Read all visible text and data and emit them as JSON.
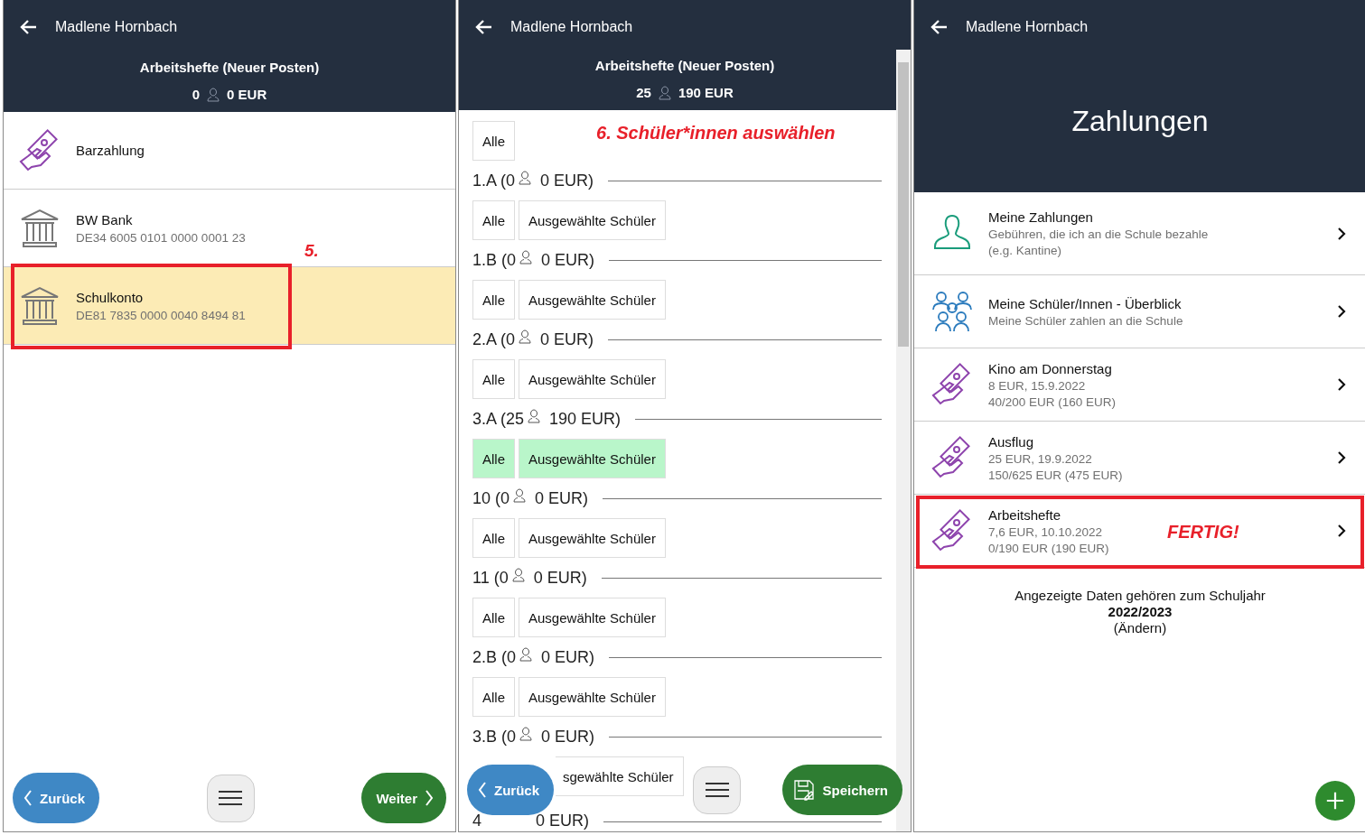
{
  "left_screen": {
    "user": "Madlene Hornbach",
    "title": "Arbeitshefte (Neuer Posten)",
    "count": "0",
    "amount": "0 EUR",
    "annotation": "5.",
    "accounts": [
      {
        "kind": "cash",
        "name": "Barzahlung",
        "selected": false,
        "highlighted": false
      },
      {
        "kind": "bank",
        "name": "BW Bank",
        "iban": "DE34 6005 0101 0000 0001 23",
        "selected": false,
        "highlighted": false
      },
      {
        "kind": "bank",
        "name": "Schulkonto",
        "iban": "DE81 7835 0000 0040 8494 81",
        "selected": true,
        "highlighted": true
      }
    ],
    "back_button": "Zurück",
    "next_button": "Weiter"
  },
  "middle_screen": {
    "user": "Madlene Hornbach",
    "title": "Arbeitshefte (Neuer Posten)",
    "count": "25",
    "amount": "190 EUR",
    "all_button": "Alle",
    "note": "6. Schüler*innen auswählen",
    "classes": [
      {
        "name": "1.A (0",
        "amount": "0 EUR)",
        "buttons": [
          {
            "label": "Alle",
            "selected": false,
            "covered": false
          },
          {
            "label": "Ausgewählte Schüler",
            "selected": false,
            "covered": false
          }
        ]
      },
      {
        "name": "1.B (0",
        "amount": "0 EUR)",
        "buttons": [
          {
            "label": "Alle",
            "selected": false,
            "covered": false
          },
          {
            "label": "Ausgewählte Schüler",
            "selected": false,
            "covered": false
          }
        ]
      },
      {
        "name": "2.A (0",
        "amount": "0 EUR)",
        "buttons": [
          {
            "label": "Alle",
            "selected": false,
            "covered": false
          },
          {
            "label": "Ausgewählte Schüler",
            "selected": false,
            "covered": false
          }
        ]
      },
      {
        "name": "3.A (25",
        "amount": "190 EUR)",
        "buttons": [
          {
            "label": "Alle",
            "selected": true,
            "covered": false
          },
          {
            "label": "Ausgewählte Schüler",
            "selected": true,
            "covered": false
          }
        ]
      },
      {
        "name": "10 (0",
        "amount": "0 EUR)",
        "buttons": [
          {
            "label": "Alle",
            "selected": false,
            "covered": false
          },
          {
            "label": "Ausgewählte Schüler",
            "selected": false,
            "covered": false
          }
        ]
      },
      {
        "name": "11 (0",
        "amount": "0 EUR)",
        "buttons": [
          {
            "label": "Alle",
            "selected": false,
            "covered": false
          },
          {
            "label": "Ausgewählte Schüler",
            "selected": false,
            "covered": false
          }
        ]
      },
      {
        "name": "2.B (0",
        "amount": "0 EUR)",
        "buttons": [
          {
            "label": "Alle",
            "selected": false,
            "covered": false
          },
          {
            "label": "Ausgewählte Schüler",
            "selected": false,
            "covered": false
          }
        ]
      },
      {
        "name": "3.B (0",
        "amount": "0 EUR)",
        "buttons": [
          {
            "label": "sgewählte Schüler",
            "selected": false,
            "covered": true
          }
        ]
      }
    ],
    "cut_row": {
      "name": "4",
      "amount": "0 EUR)"
    },
    "back_button": "Zurück",
    "save_button": "Speichern"
  },
  "right_screen": {
    "user": "Madlene Hornbach",
    "heading": "Zahlungen",
    "items": [
      {
        "kind": "person",
        "title": "Meine Zahlungen",
        "lines": [
          "Gebühren, die ich an die Schule bezahle",
          "(e.g. Kantine)"
        ],
        "highlighted": false
      },
      {
        "kind": "group",
        "title": "Meine Schüler/Innen - Überblick",
        "lines": [
          "Meine Schüler zahlen an die Schule"
        ],
        "highlighted": false
      },
      {
        "kind": "cash",
        "title": "Kino am Donnerstag",
        "lines": [
          "8 EUR, 15.9.2022",
          "40/200 EUR (160 EUR)"
        ],
        "highlighted": false
      },
      {
        "kind": "cash",
        "title": "Ausflug",
        "lines": [
          "25 EUR, 19.9.2022",
          "150/625 EUR (475 EUR)"
        ],
        "highlighted": false
      },
      {
        "kind": "cash",
        "title": "Arbeitshefte",
        "lines": [
          "7,6 EUR, 10.10.2022",
          "0/190 EUR (190 EUR)"
        ],
        "highlighted": true,
        "note": "FERTIG!"
      }
    ],
    "footer_text": "Angezeigte Daten gehören zum Schuljahr",
    "school_year": "2022/2023",
    "change_link": "(Ändern)"
  }
}
